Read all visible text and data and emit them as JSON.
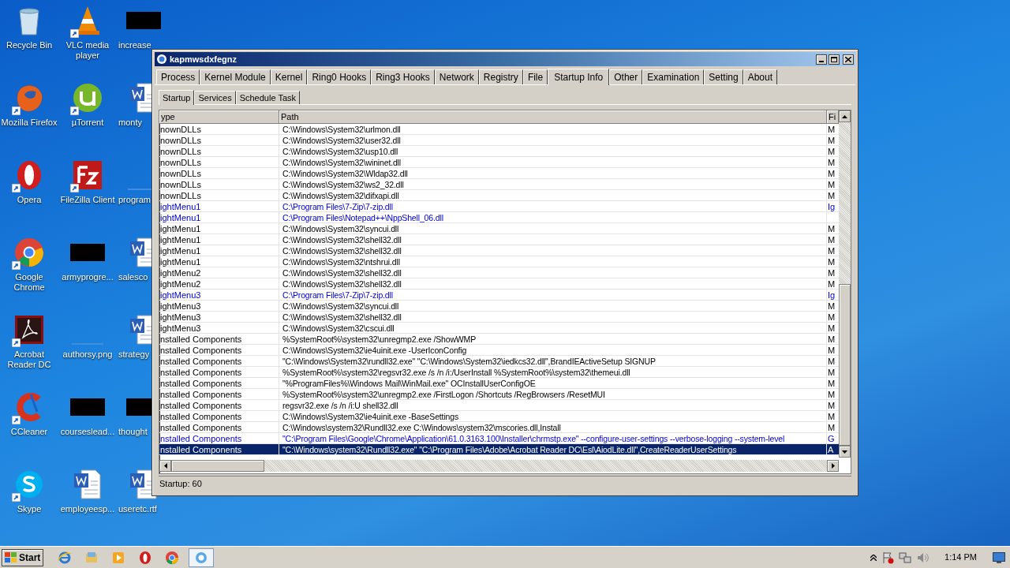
{
  "desktop_icons": [
    {
      "label": "Recycle Bin",
      "kind": "recycle"
    },
    {
      "label": "VLC media player",
      "kind": "vlc",
      "shortcut": true
    },
    {
      "label": "increase",
      "kind": "black"
    },
    {
      "label": "Mozilla Firefox",
      "kind": "firefox",
      "shortcut": true
    },
    {
      "label": "µTorrent",
      "kind": "utorrent",
      "shortcut": true
    },
    {
      "label": "monty",
      "kind": "word"
    },
    {
      "label": "Opera",
      "kind": "opera",
      "shortcut": true
    },
    {
      "label": "FileZilla Client",
      "kind": "filezilla",
      "shortcut": true
    },
    {
      "label": "program",
      "kind": "blank"
    },
    {
      "label": "Google Chrome",
      "kind": "chrome",
      "shortcut": true
    },
    {
      "label": "armyprogre...",
      "kind": "black"
    },
    {
      "label": "salesco",
      "kind": "word"
    },
    {
      "label": "Acrobat Reader DC",
      "kind": "acrobat",
      "shortcut": true
    },
    {
      "label": "authorsy.png",
      "kind": "blank"
    },
    {
      "label": "strategy",
      "kind": "word"
    },
    {
      "label": "CCleaner",
      "kind": "ccleaner",
      "shortcut": true
    },
    {
      "label": "courseslead...",
      "kind": "black"
    },
    {
      "label": "thought",
      "kind": "black"
    },
    {
      "label": "Skype",
      "kind": "skype",
      "shortcut": true
    },
    {
      "label": "employeesp...",
      "kind": "word"
    },
    {
      "label": "useretc.rtf",
      "kind": "word"
    }
  ],
  "window": {
    "title": "kapmwsdxfegnz",
    "tabs": [
      {
        "label": "Process",
        "selected": false
      },
      {
        "label": "Kernel Module",
        "selected": false
      },
      {
        "label": "Kernel",
        "selected": false
      },
      {
        "label": "Ring0 Hooks",
        "selected": false
      },
      {
        "label": "Ring3 Hooks",
        "selected": false
      },
      {
        "label": "Network",
        "selected": false
      },
      {
        "label": "Registry",
        "selected": false
      },
      {
        "label": "File",
        "selected": false
      },
      {
        "label": "Startup Info",
        "selected": true
      },
      {
        "label": "Other",
        "selected": false
      },
      {
        "label": "Examination",
        "selected": false
      },
      {
        "label": "Setting",
        "selected": false
      },
      {
        "label": "About",
        "selected": false
      }
    ],
    "subtabs": [
      {
        "label": "Startup",
        "selected": true
      },
      {
        "label": "Services",
        "selected": false
      },
      {
        "label": "Schedule Task",
        "selected": false
      }
    ],
    "table": {
      "columns": [
        "ype",
        "Path",
        "Fi"
      ],
      "rows": [
        {
          "type": "nownDLLs",
          "path": "C:\\Windows\\System32\\urlmon.dll",
          "column_3": "M",
          "highlighted": false,
          "selected": false
        },
        {
          "type": "nownDLLs",
          "path": "C:\\Windows\\System32\\user32.dll",
          "column_3": "M",
          "highlighted": false,
          "selected": false
        },
        {
          "type": "nownDLLs",
          "path": "C:\\Windows\\System32\\usp10.dll",
          "column_3": "M",
          "highlighted": false,
          "selected": false
        },
        {
          "type": "nownDLLs",
          "path": "C:\\Windows\\System32\\wininet.dll",
          "column_3": "M",
          "highlighted": false,
          "selected": false
        },
        {
          "type": "nownDLLs",
          "path": "C:\\Windows\\System32\\Wldap32.dll",
          "column_3": "M",
          "highlighted": false,
          "selected": false
        },
        {
          "type": "nownDLLs",
          "path": "C:\\Windows\\System32\\ws2_32.dll",
          "column_3": "M",
          "highlighted": false,
          "selected": false
        },
        {
          "type": "nownDLLs",
          "path": "C:\\Windows\\System32\\difxapi.dll",
          "column_3": "M",
          "highlighted": false,
          "selected": false
        },
        {
          "type": "ightMenu1",
          "path": "C:\\Program Files\\7-Zip\\7-zip.dll",
          "column_3": "Ig",
          "highlighted": true,
          "selected": false
        },
        {
          "type": "ightMenu1",
          "path": "C:\\Program Files\\Notepad++\\NppShell_06.dll",
          "highlighted": true,
          "selected": false
        },
        {
          "type": "ightMenu1",
          "path": "C:\\Windows\\System32\\syncui.dll",
          "column_3": "M",
          "highlighted": false,
          "selected": false
        },
        {
          "type": "ightMenu1",
          "path": "C:\\Windows\\System32\\shell32.dll",
          "column_3": "M",
          "highlighted": false,
          "selected": false
        },
        {
          "type": "ightMenu1",
          "path": "C:\\Windows\\System32\\shell32.dll",
          "column_3": "M",
          "highlighted": false,
          "selected": false
        },
        {
          "type": "ightMenu1",
          "path": "C:\\Windows\\System32\\ntshrui.dll",
          "column_3": "M",
          "highlighted": false,
          "selected": false
        },
        {
          "type": "ightMenu2",
          "path": "C:\\Windows\\System32\\shell32.dll",
          "column_3": "M",
          "highlighted": false,
          "selected": false
        },
        {
          "type": "ightMenu2",
          "path": "C:\\Windows\\System32\\shell32.dll",
          "column_3": "M",
          "highlighted": false,
          "selected": false
        },
        {
          "type": "ightMenu3",
          "path": "C:\\Program Files\\7-Zip\\7-zip.dll",
          "column_3": "Ig",
          "highlighted": true,
          "selected": false
        },
        {
          "type": "ightMenu3",
          "path": "C:\\Windows\\System32\\syncui.dll",
          "column_3": "M",
          "highlighted": false,
          "selected": false
        },
        {
          "type": "ightMenu3",
          "path": "C:\\Windows\\System32\\shell32.dll",
          "column_3": "M",
          "highlighted": false,
          "selected": false
        },
        {
          "type": "ightMenu3",
          "path": "C:\\Windows\\System32\\cscui.dll",
          "column_3": "M",
          "highlighted": false,
          "selected": false
        },
        {
          "type": "nstalled Components",
          "path": "%SystemRoot%\\system32\\unregmp2.exe /ShowWMP",
          "column_3": "M",
          "highlighted": false,
          "selected": false
        },
        {
          "type": "nstalled Components",
          "path": "C:\\Windows\\System32\\ie4uinit.exe -UserIconConfig",
          "column_3": "M",
          "highlighted": false,
          "selected": false
        },
        {
          "type": "nstalled Components",
          "path": "\"C:\\Windows\\System32\\rundll32.exe\" \"C:\\Windows\\System32\\iedkcs32.dll\",BrandIEActiveSetup SIGNUP",
          "column_3": "M",
          "highlighted": false,
          "selected": false
        },
        {
          "type": "nstalled Components",
          "path": "%SystemRoot%\\system32\\regsvr32.exe /s /n /i:/UserInstall %SystemRoot%\\system32\\themeui.dll",
          "column_3": "M",
          "highlighted": false,
          "selected": false
        },
        {
          "type": "nstalled Components",
          "path": "\"%ProgramFiles%\\Windows Mail\\WinMail.exe\" OCInstallUserConfigOE",
          "column_3": "M",
          "highlighted": false,
          "selected": false
        },
        {
          "type": "nstalled Components",
          "path": "%SystemRoot%\\system32\\unregmp2.exe /FirstLogon /Shortcuts /RegBrowsers /ResetMUI",
          "column_3": "M",
          "highlighted": false,
          "selected": false
        },
        {
          "type": "nstalled Components",
          "path": "regsvr32.exe /s /n /i:U shell32.dll",
          "column_3": "M",
          "highlighted": false,
          "selected": false
        },
        {
          "type": "nstalled Components",
          "path": "C:\\Windows\\System32\\ie4uinit.exe -BaseSettings",
          "column_3": "M",
          "highlighted": false,
          "selected": false
        },
        {
          "type": "nstalled Components",
          "path": "C:\\Windows\\system32\\Rundll32.exe C:\\Windows\\system32\\mscories.dll,Install",
          "column_3": "M",
          "highlighted": false,
          "selected": false
        },
        {
          "type": "nstalled Components",
          "path": "\"C:\\Program Files\\Google\\Chrome\\Application\\61.0.3163.100\\Installer\\chrmstp.exe\" --configure-user-settings --verbose-logging --system-level",
          "column_3": "G",
          "highlighted": true,
          "selected": false
        },
        {
          "type": "nstalled Components",
          "path": "\"C:\\Windows\\system32\\Rundll32.exe\" \"C:\\Program Files\\Adobe\\Acrobat Reader DC\\Esl\\AiodLite.dll\",CreateReaderUserSettings",
          "column_3": "A",
          "highlighted": false,
          "selected": true
        }
      ]
    },
    "status_bar": "Startup: 60"
  },
  "taskbar": {
    "start": "Start",
    "apps": [
      {
        "kind": "ie",
        "selected": false
      },
      {
        "kind": "explorer",
        "selected": false
      },
      {
        "kind": "media",
        "selected": false
      },
      {
        "kind": "opera",
        "selected": false
      },
      {
        "kind": "chrome",
        "selected": false
      },
      {
        "kind": "app",
        "selected": true
      }
    ],
    "clock": "1:14 PM"
  }
}
